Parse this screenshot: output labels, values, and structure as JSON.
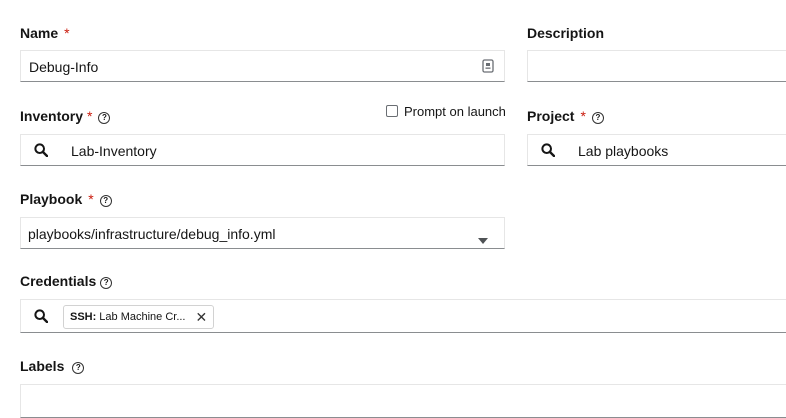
{
  "form": {
    "name": {
      "label": "Name",
      "required": "*",
      "value": "Debug-Info"
    },
    "description": {
      "label": "Description",
      "value": ""
    },
    "inventory": {
      "label": "Inventory",
      "required": "*",
      "help": "?",
      "value": "Lab-Inventory",
      "prompt_label": "Prompt on launch"
    },
    "project": {
      "label": "Project",
      "required": "*",
      "help": "?",
      "value": "Lab playbooks"
    },
    "playbook": {
      "label": "Playbook",
      "required": "*",
      "help": "?",
      "value": "playbooks/infrastructure/debug_info.yml"
    },
    "credentials": {
      "label": "Credentials",
      "help": "?",
      "chip_type": "SSH:",
      "chip_name": "Lab Machine Cr...",
      "chip_close": "✕"
    },
    "labels": {
      "label": "Labels",
      "help": "?"
    }
  },
  "icons": {
    "search": "search-icon",
    "dropdown": "caret-down-icon",
    "clipboard": "clipboard-icon"
  },
  "colors": {
    "required": "#c9190b",
    "border_bottom": "#8a8d90",
    "border": "#e6e6e6"
  }
}
